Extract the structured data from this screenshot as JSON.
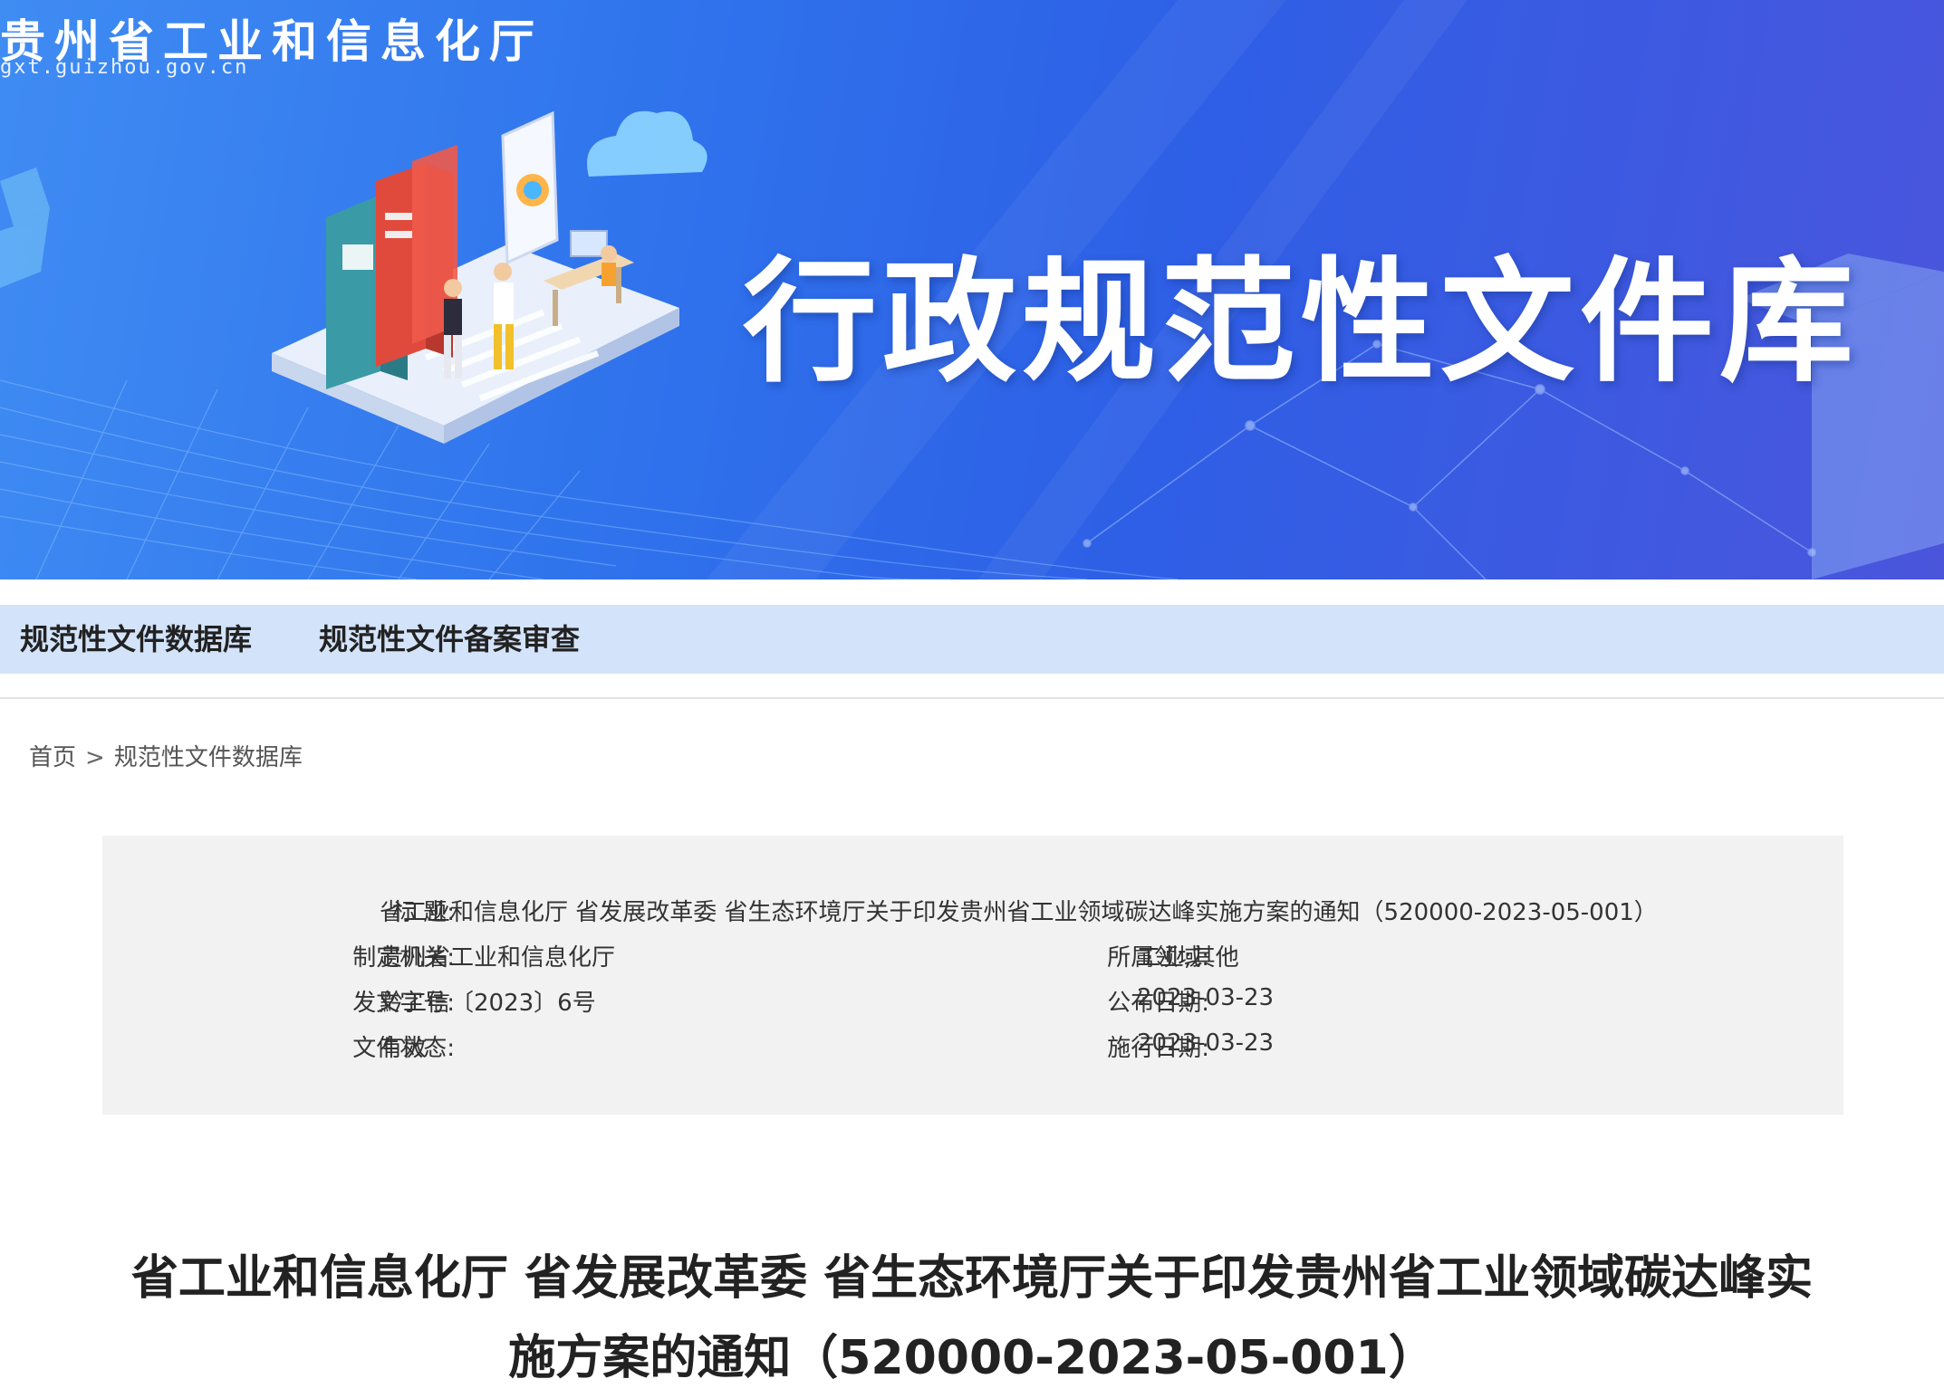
{
  "header": {
    "site_name": "贵州省工业和信息化厅",
    "site_domain": "gxt.guizhou.gov.cn",
    "banner_title": "行政规范性文件库"
  },
  "nav": {
    "items": [
      "规范性文件数据库",
      "规范性文件备案审查"
    ]
  },
  "breadcrumb": {
    "home": "首页",
    "separator": ">",
    "current": "规范性文件数据库"
  },
  "document_info": {
    "title_label": "标  题:",
    "title_value": "省工业和信息化厅 省发展改革委 省生态环境厅关于印发贵州省工业领域碳达峰实施方案的通知（520000-2023-05-001）",
    "issuer_label": "制定机关:",
    "issuer_value": "贵州省工业和信息化厅",
    "field_label": "所属领域:",
    "field_value": "工业;其他",
    "doc_number_label": "发文字号:",
    "doc_number_value": "黔工信〔2023〕6号",
    "publish_date_label": "公布日期:",
    "publish_date_value": "2023-03-23",
    "status_label": "文件状态:",
    "status_value": "有效",
    "effective_date_label": "施行日期:",
    "effective_date_value": "2023-03-23"
  },
  "article": {
    "title_line1": "省工业和信息化厅 省发展改革委 省生态环境厅关于印发贵州省工业领域碳达峰实",
    "title_line2": "施方案的通知（520000-2023-05-001）"
  },
  "colors": {
    "banner_start": "#3f8cf3",
    "banner_end": "#4a55dc",
    "nav_bg": "#d3e3fa",
    "info_bg": "#f2f2f2"
  }
}
